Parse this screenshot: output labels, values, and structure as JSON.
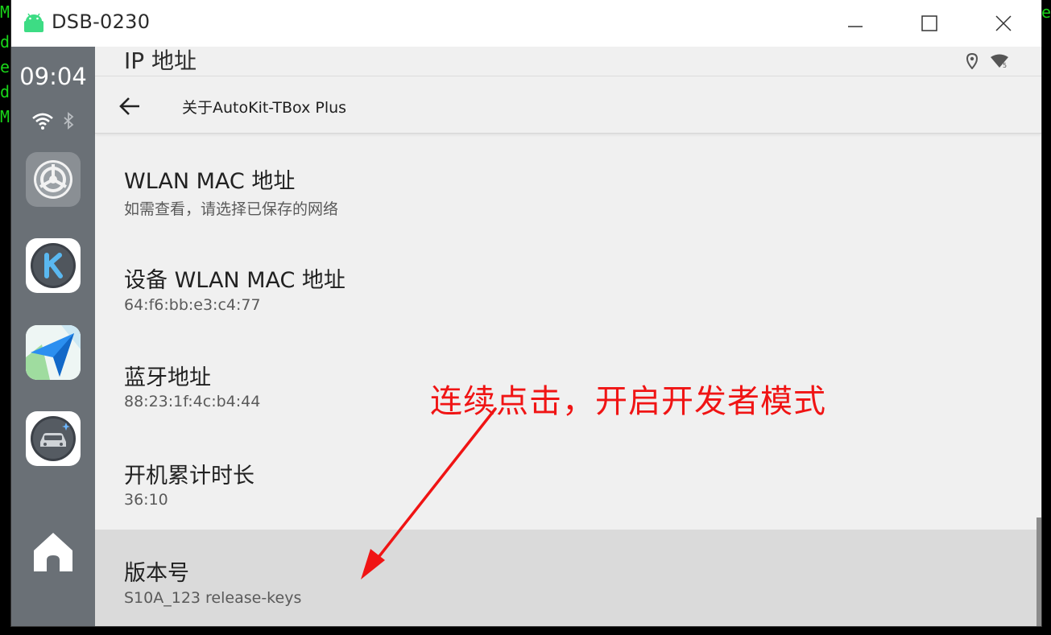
{
  "terminal": {
    "left_lines": [
      "M",
      "d",
      "e",
      "d",
      "M"
    ],
    "right_line": "e"
  },
  "window": {
    "title": "DSB-0230",
    "minimize": "minimize",
    "maximize": "maximize",
    "close": "close"
  },
  "rail": {
    "time": "09:04"
  },
  "status": {
    "ghost_title": "IP 地址"
  },
  "header": {
    "title": "关于AutoKit-TBox Plus"
  },
  "items": [
    {
      "title": "WLAN MAC 地址",
      "subtitle": "如需查看，请选择已保存的网络"
    },
    {
      "title": "设备 WLAN MAC 地址",
      "subtitle": "64:f6:bb:e3:c4:77"
    },
    {
      "title": "蓝牙地址",
      "subtitle": "88:23:1f:4c:b4:44"
    },
    {
      "title": "开机累计时长",
      "subtitle": "36:10"
    },
    {
      "title": "版本号",
      "subtitle": "S10A_123 release-keys"
    }
  ],
  "annotation": {
    "text": "连续点击，开启开发者模式",
    "color": "#f01414"
  },
  "colors": {
    "rail": "#6a7076",
    "background": "#f0f0f0",
    "selected": "#dadada",
    "android_green": "#3ddc84"
  }
}
